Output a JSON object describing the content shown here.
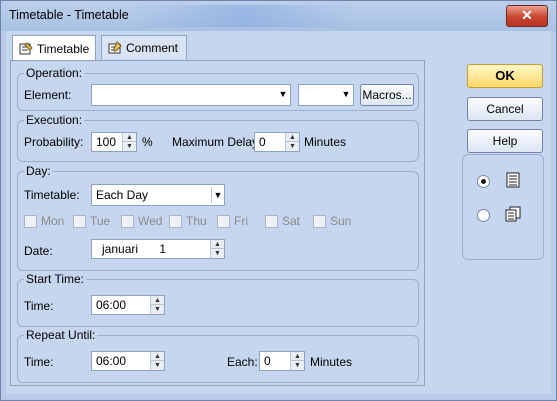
{
  "window": {
    "title": "Timetable - Timetable",
    "close_label": "✕"
  },
  "tabs": [
    {
      "label": "Timetable",
      "icon": "timetable-icon",
      "active": true
    },
    {
      "label": "Comment",
      "icon": "comment-icon",
      "active": false
    }
  ],
  "operation": {
    "group_label": "Operation:",
    "element_label": "Element:",
    "element_value": "",
    "secondary_value": "",
    "macros_label": "Macros..."
  },
  "execution": {
    "group_label": "Execution:",
    "probability_label": "Probability:",
    "probability_value": "100",
    "probability_unit": "%",
    "max_delay_label": "Maximum Delay:",
    "max_delay_value": "0",
    "max_delay_unit": "Minutes"
  },
  "day": {
    "group_label": "Day:",
    "timetable_label": "Timetable:",
    "timetable_value": "Each Day",
    "weekdays": [
      "Mon",
      "Tue",
      "Wed",
      "Thu",
      "Fri",
      "Sat",
      "Sun"
    ],
    "date_label": "Date:",
    "date_month": "januari",
    "date_day": "1"
  },
  "start_time": {
    "group_label": "Start Time:",
    "time_label": "Time:",
    "time_value": "06:00"
  },
  "repeat_until": {
    "group_label": "Repeat Until:",
    "time_label": "Time:",
    "time_value": "06:00",
    "each_label": "Each:",
    "each_value": "0",
    "each_unit": "Minutes"
  },
  "buttons": {
    "ok": "OK",
    "cancel": "Cancel",
    "help": "Help"
  },
  "view_options": [
    {
      "icon": "list-view-icon",
      "selected": true
    },
    {
      "icon": "copy-view-icon",
      "selected": false
    }
  ]
}
